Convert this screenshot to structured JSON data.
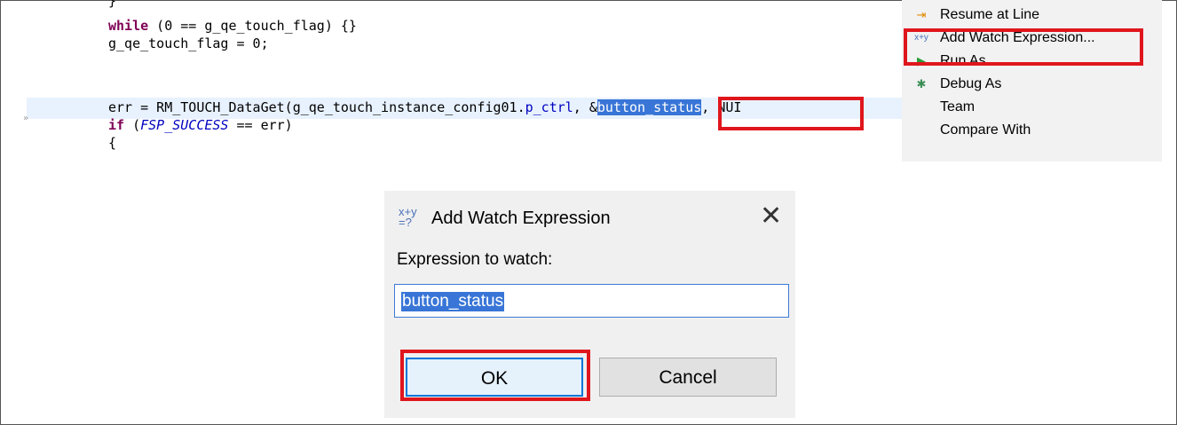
{
  "editor": {
    "lines": [
      {
        "segments": [
          {
            "t": "}",
            "c": ""
          }
        ]
      },
      {
        "segments": [
          {
            "t": "while",
            "c": "kw"
          },
          {
            "t": " (0 == g_qe_touch_flag) {}",
            "c": ""
          }
        ]
      },
      {
        "segments": [
          {
            "t": "g_qe_touch_flag = 0;",
            "c": ""
          }
        ]
      },
      {
        "segments": [
          {
            "t": "",
            "c": ""
          }
        ]
      },
      {
        "segments": [
          {
            "t": "err = RM_TOUCH_DataGet(g_qe_touch_instance_config01.",
            "c": ""
          },
          {
            "t": "p_ctrl",
            "c": "field"
          },
          {
            "t": ", &",
            "c": ""
          },
          {
            "t": "button_status",
            "c": "sel-text"
          },
          {
            "t": ", NUI",
            "c": ""
          }
        ]
      },
      {
        "segments": [
          {
            "t": "if",
            "c": "kw"
          },
          {
            "t": " (",
            "c": ""
          },
          {
            "t": "FSP_SUCCESS",
            "c": "const"
          },
          {
            "t": " == err)",
            "c": ""
          }
        ]
      },
      {
        "segments": [
          {
            "t": "{",
            "c": ""
          }
        ]
      }
    ]
  },
  "context_menu": {
    "items": [
      {
        "label": "Resume at Line",
        "icon": "resume-at-line-icon",
        "glyph": "⇥",
        "color": "#e08a00"
      },
      {
        "label": "Add Watch Expression...",
        "icon": "watch-expression-icon",
        "glyph": "x+y",
        "color": "#4a70b8"
      },
      {
        "label": "Run As",
        "icon": "run-icon",
        "glyph": "▶",
        "color": "#2a9d3a"
      },
      {
        "label": "Debug As",
        "icon": "bug-icon",
        "glyph": "✱",
        "color": "#3a8f55"
      },
      {
        "label": "Team",
        "icon": "",
        "glyph": "",
        "color": ""
      },
      {
        "label": "Compare With",
        "icon": "",
        "glyph": "",
        "color": ""
      }
    ]
  },
  "dialog": {
    "title": "Add Watch Expression",
    "icon": "watch-expression-icon",
    "close_icon": "close-icon",
    "field_label": "Expression to watch:",
    "field_value": "button_status",
    "ok_label": "OK",
    "cancel_label": "Cancel"
  },
  "colors": {
    "highlight_red": "#e0161d",
    "selection_blue": "#3875d7",
    "keyword": "#7f0055"
  }
}
